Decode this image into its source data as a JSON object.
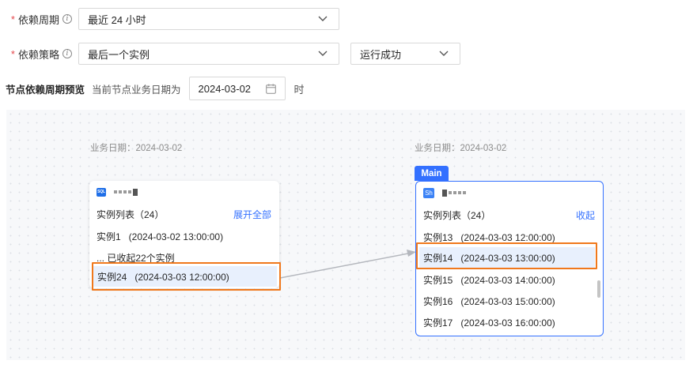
{
  "form": {
    "cycle": {
      "label": "依赖周期",
      "value": "最近 24 小时"
    },
    "strategy": {
      "label": "依赖策略",
      "value": "最后一个实例",
      "status_value": "运行成功"
    }
  },
  "preview": {
    "title": "节点依赖周期预览",
    "hint": "当前节点业务日期为",
    "date": "2024-03-02",
    "suffix": "时"
  },
  "graph": {
    "left": {
      "biz_date": "业务日期：2024-03-02",
      "icon_text": "SQL",
      "list_title": "实例列表（24）",
      "expand_label": "展开全部",
      "first_instance": "实例1   (2024-03-02 13:00:00)",
      "collapsed_note": "... 已收起22个实例",
      "highlighted_instance": "实例24   (2024-03-03 12:00:00)"
    },
    "right": {
      "tag": "Main",
      "biz_date": "业务日期：2024-03-02",
      "icon_text": "Sh",
      "list_title": "实例列表（24）",
      "collapse_label": "收起",
      "instances": [
        "实例13   (2024-03-03 12:00:00)",
        "实例14   (2024-03-03 13:00:00)",
        "实例15   (2024-03-03 14:00:00)",
        "实例16   (2024-03-03 15:00:00)",
        "实例17   (2024-03-03 16:00:00)"
      ]
    },
    "colors": {
      "accent": "#3370ff",
      "highlight_border": "#f0781c",
      "highlight_bg": "#e8f0fd"
    }
  }
}
